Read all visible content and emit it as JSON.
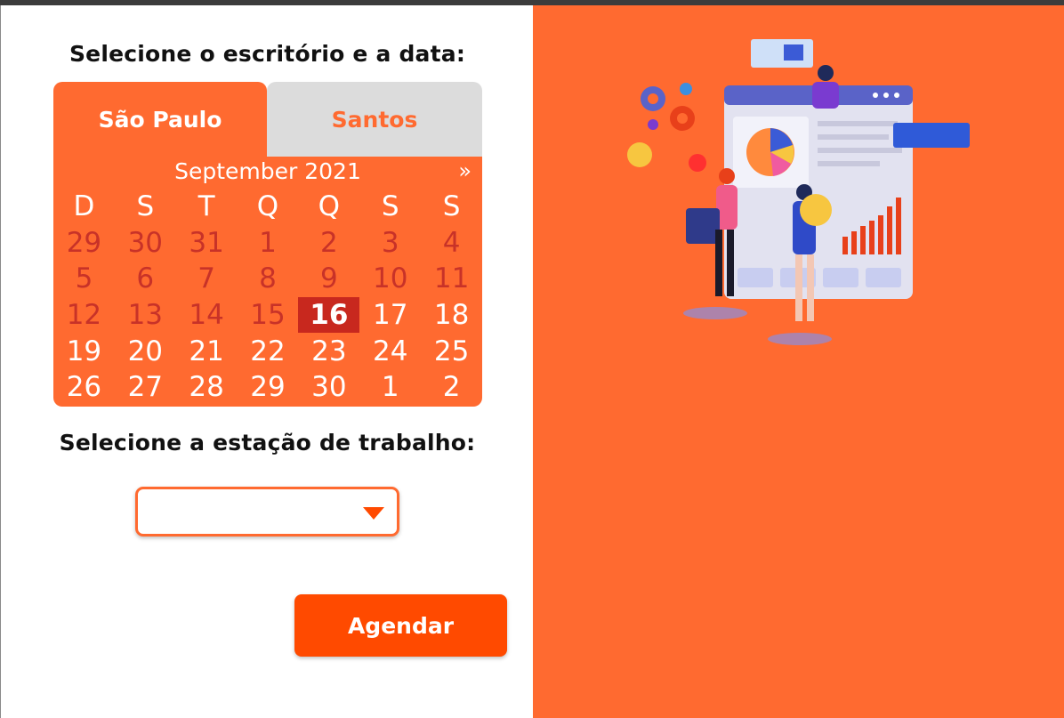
{
  "form": {
    "office_heading": "Selecione o escritório e a data:",
    "workstation_heading": "Selecione a estação de trabalho:",
    "submit_label": "Agendar",
    "workstation_value": ""
  },
  "tabs": [
    {
      "label": "São Paulo",
      "active": true
    },
    {
      "label": "Santos",
      "active": false
    }
  ],
  "calendar": {
    "month_label": "September 2021",
    "next_label": "»",
    "weekdays": [
      "D",
      "S",
      "T",
      "Q",
      "Q",
      "S",
      "S"
    ],
    "weeks": [
      [
        "29",
        "30",
        "31",
        "1",
        "2",
        "3",
        "4"
      ],
      [
        "5",
        "6",
        "7",
        "8",
        "9",
        "10",
        "11"
      ],
      [
        "12",
        "13",
        "14",
        "15",
        "16",
        "17",
        "18"
      ],
      [
        "19",
        "20",
        "21",
        "22",
        "23",
        "24",
        "25"
      ],
      [
        "26",
        "27",
        "28",
        "29",
        "30",
        "1",
        "2"
      ]
    ],
    "disabled_count_before_today": 18,
    "selected_day": "16"
  },
  "colors": {
    "accent": "#ff6a30",
    "button": "#ff4a00",
    "selected_day_bg": "#c8281e",
    "disabled_day": "#c83228"
  }
}
